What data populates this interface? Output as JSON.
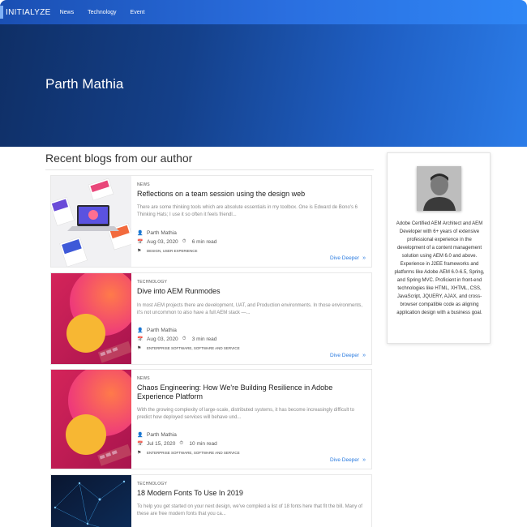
{
  "brand": {
    "name": "INITIALYZE"
  },
  "nav": {
    "links": [
      "News",
      "Technology",
      "Event"
    ]
  },
  "hero": {
    "title": "Parth Mathia"
  },
  "section": {
    "title": "Recent blogs from our author"
  },
  "posts": [
    {
      "category": "NEWS",
      "title": "Reflections on a team session using the design web",
      "excerpt": "There are some thinking tools which are absolute essentials in my toolbox. One is Edward de Bono's 6 Thinking Hats; I use it so often it feels friendl...",
      "author": "Parth Mathia",
      "date": "Aug 03, 2020",
      "read_time": "6 min read",
      "tags": "DESIGN, USER EXPERIENCE",
      "cta": "Dive Deeper"
    },
    {
      "category": "TECHNOLOGY",
      "title": "Dive into AEM Runmodes",
      "excerpt": "In most AEM projects there are development, UAT, and Production environments. In those environments, it's not uncommon to also have a full AEM stack —...",
      "author": "Parth Mathia",
      "date": "Aug 03, 2020",
      "read_time": "3 min read",
      "tags": "ENTERPRISE SOFTWARE, SOFTWARE AND SERVICE",
      "cta": "Dive Deeper"
    },
    {
      "category": "NEWS",
      "title": "Chaos Engineering: How We're Building Resilience in Adobe Experience Platform",
      "excerpt": "With the growing complexity of large-scale, distributed systems, it has become increasingly difficult to predict how deployed services will behave und...",
      "author": "Parth Mathia",
      "date": "Jul 15, 2020",
      "read_time": "10 min read",
      "tags": "ENTERPRISE SOFTWARE, SOFTWARE AND SERVICE",
      "cta": "Dive Deeper"
    },
    {
      "category": "TECHNOLOGY",
      "title": "18 Modern Fonts To Use In 2019",
      "excerpt": "To help you get started on your next design, we've compiled a list of 18 fonts here that fit the bill. Many of these are free modern fonts that you ca..."
    }
  ],
  "author": {
    "bio": "Adobe Certified AEM Architect and AEM Developer with 6+ years of extensive professional experience in the development of a content management solution using AEM 6.0 and above. Experience in J2EE frameworks and platforms like Adobe AEM 6.0-6.5, Spring, and Spring MVC. Proficient in front-end technologies like HTML, XHTML, CSS, JavaScript, JQUERY, AJAX, and cross-browser compatible code as aligning application design with a business goal."
  },
  "icons": {
    "author": "user-icon",
    "date": "calendar-icon",
    "read_time": "stopwatch-icon",
    "tags": "tag-icon",
    "cta": "double-chevron-right-icon"
  },
  "colors": {
    "accent": "#2a7be0",
    "nav_start": "#1a4fb3",
    "hero_start": "#0f2f66",
    "hero_end": "#2b7ce8"
  }
}
